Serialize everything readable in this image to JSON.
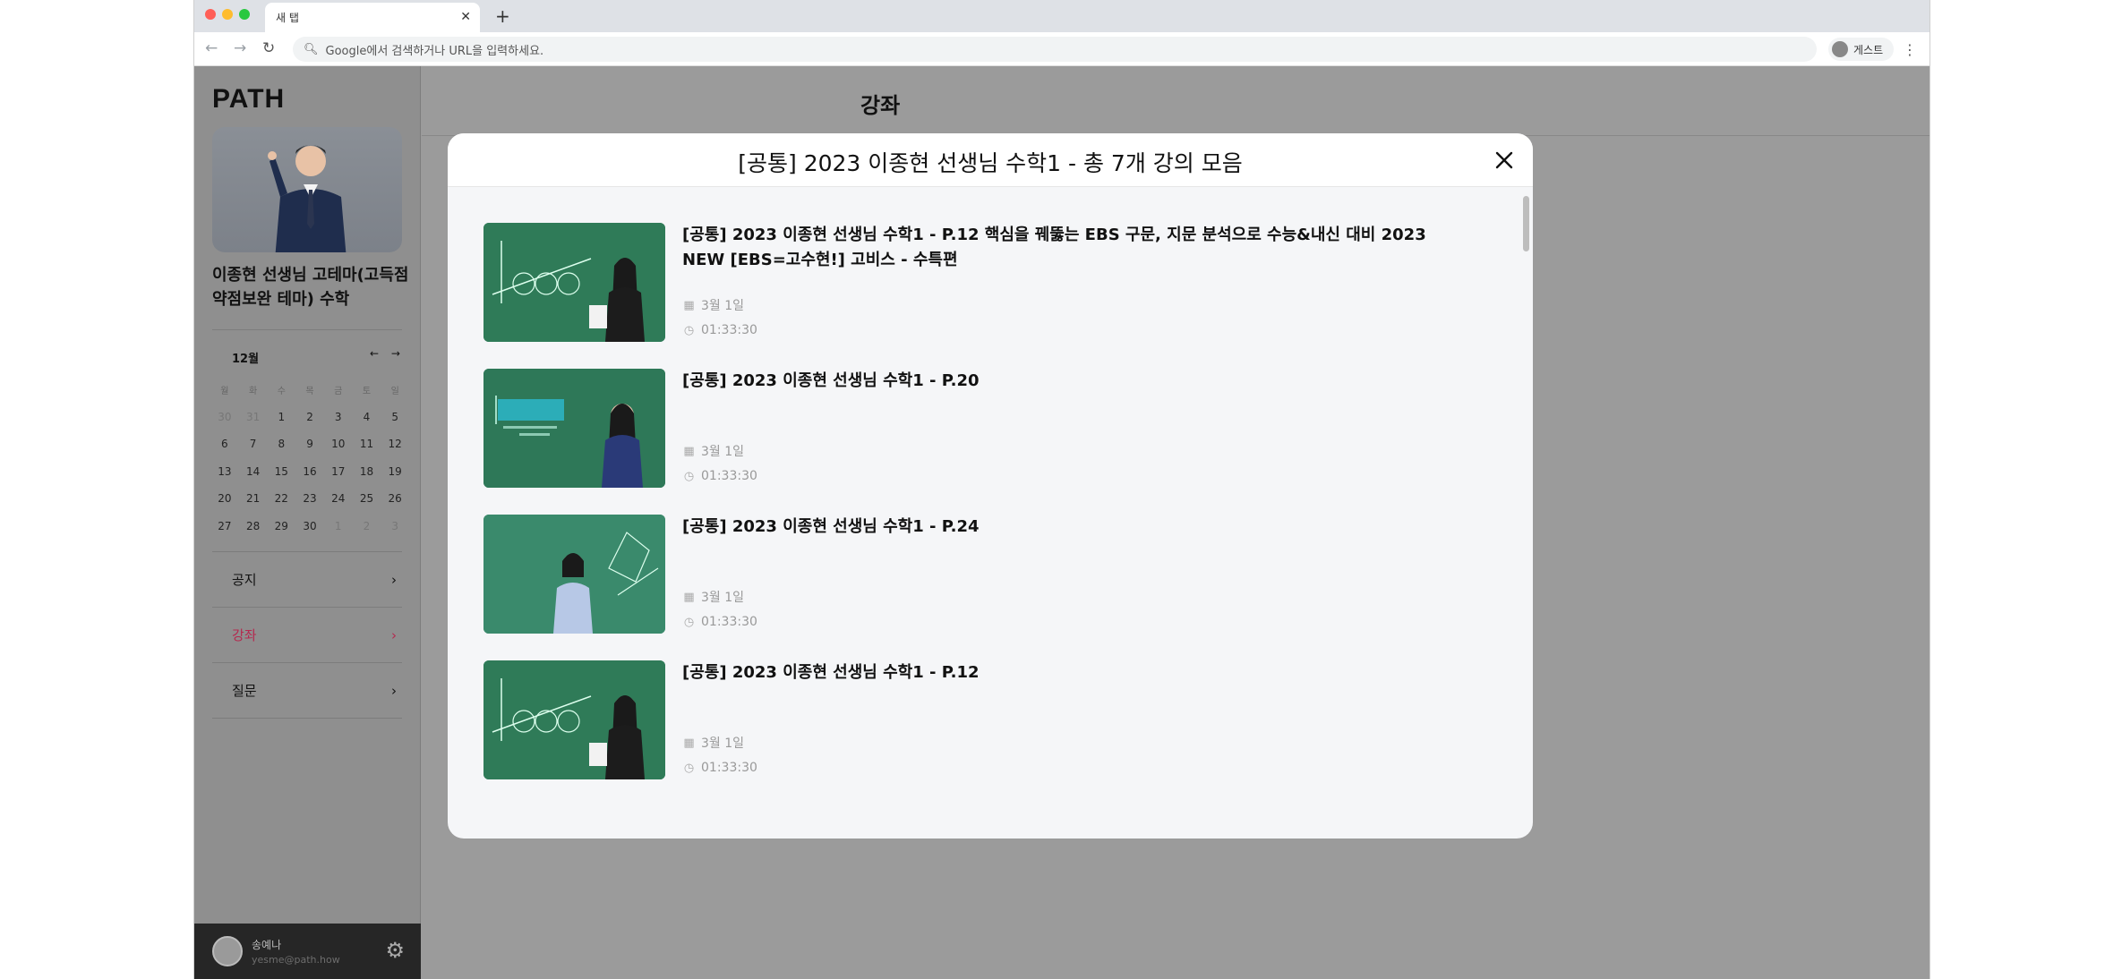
{
  "browser": {
    "tab_title": "새 탭",
    "address_placeholder": "Google에서 검색하거나 URL을 입력하세요.",
    "profile_label": "게스트"
  },
  "sidebar": {
    "logo": "PATH",
    "teacher_name": "이종현 선생님 고테마(고득점 약점보완 테마) 수학",
    "calendar": {
      "month": "12월",
      "weekdays": [
        "월",
        "화",
        "수",
        "목",
        "금",
        "토",
        "일"
      ],
      "weeks": [
        [
          "30",
          "31",
          "1",
          "2",
          "3",
          "4",
          "5"
        ],
        [
          "6",
          "7",
          "8",
          "9",
          "10",
          "11",
          "12"
        ],
        [
          "13",
          "14",
          "15",
          "16",
          "17",
          "18",
          "19"
        ],
        [
          "20",
          "21",
          "22",
          "23",
          "24",
          "25",
          "26"
        ],
        [
          "27",
          "28",
          "29",
          "30",
          "1",
          "2",
          "3"
        ]
      ]
    },
    "menu": [
      {
        "label": "공지",
        "active": false
      },
      {
        "label": "강좌",
        "active": true
      },
      {
        "label": "질문",
        "active": false
      }
    ],
    "user": {
      "name": "송예나",
      "email": "yesme@path.how"
    }
  },
  "main": {
    "title": "강좌"
  },
  "modal": {
    "title": "[공통] 2023 이종현 선생님 수학1 - 총 7개 강의 모음",
    "lectures": [
      {
        "title": "[공통] 2023 이종현 선생님 수학1 - P.12 핵심을 꿰뚫는 EBS 구문, 지문 분석으로 수능&내신 대비 2023 NEW [EBS=고수현!] 고비스 - 수특편",
        "date": "3월 1일",
        "duration": "01:33:30"
      },
      {
        "title": "[공통] 2023 이종현 선생님 수학1 - P.20",
        "date": "3월 1일",
        "duration": "01:33:30"
      },
      {
        "title": "[공통] 2023 이종현 선생님 수학1 - P.24",
        "date": "3월 1일",
        "duration": "01:33:30"
      },
      {
        "title": "[공통] 2023 이종현 선생님 수학1 - P.12",
        "date": "3월 1일",
        "duration": "01:33:30"
      }
    ]
  }
}
